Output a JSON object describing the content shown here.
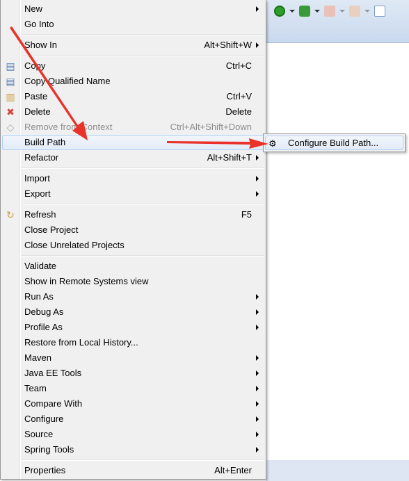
{
  "colors": {
    "arrow": "#e8322a",
    "highlight": "#e2ebf7",
    "menu_bg": "#f0f0f0"
  },
  "menu": {
    "items": [
      {
        "label": "New",
        "shortcut": "",
        "submenu": true
      },
      {
        "label": "Go Into",
        "shortcut": ""
      },
      {
        "separator": true
      },
      {
        "label": "Show In",
        "shortcut": "Alt+Shift+W",
        "submenu": true
      },
      {
        "separator": true
      },
      {
        "label": "Copy",
        "shortcut": "Ctrl+C",
        "icon": "copy-icon"
      },
      {
        "label": "Copy Qualified Name",
        "shortcut": "",
        "icon": "copy-qualified-name-icon"
      },
      {
        "label": "Paste",
        "shortcut": "Ctrl+V",
        "icon": "paste-icon"
      },
      {
        "label": "Delete",
        "shortcut": "Delete",
        "icon": "delete-icon"
      },
      {
        "label": "Remove from Context",
        "shortcut": "Ctrl+Alt+Shift+Down",
        "icon": "remove-context-icon",
        "disabled": true
      },
      {
        "label": "Build Path",
        "shortcut": "",
        "submenu": false,
        "highlighted": true
      },
      {
        "label": "Refactor",
        "shortcut": "Alt+Shift+T",
        "submenu": true
      },
      {
        "separator": true
      },
      {
        "label": "Import",
        "shortcut": "",
        "submenu": true
      },
      {
        "label": "Export",
        "shortcut": "",
        "submenu": true
      },
      {
        "separator": true
      },
      {
        "label": "Refresh",
        "shortcut": "F5",
        "icon": "refresh-icon"
      },
      {
        "label": "Close Project",
        "shortcut": ""
      },
      {
        "label": "Close Unrelated Projects",
        "shortcut": ""
      },
      {
        "separator": true
      },
      {
        "label": "Validate",
        "shortcut": ""
      },
      {
        "label": "Show in Remote Systems view",
        "shortcut": ""
      },
      {
        "label": "Run As",
        "shortcut": "",
        "submenu": true
      },
      {
        "label": "Debug As",
        "shortcut": "",
        "submenu": true
      },
      {
        "label": "Profile As",
        "shortcut": "",
        "submenu": true
      },
      {
        "label": "Restore from Local History...",
        "shortcut": ""
      },
      {
        "label": "Maven",
        "shortcut": "",
        "submenu": true
      },
      {
        "label": "Java EE Tools",
        "shortcut": "",
        "submenu": true
      },
      {
        "label": "Team",
        "shortcut": "",
        "submenu": true
      },
      {
        "label": "Compare With",
        "shortcut": "",
        "submenu": true
      },
      {
        "label": "Configure",
        "shortcut": "",
        "submenu": true
      },
      {
        "label": "Source",
        "shortcut": "",
        "submenu": true
      },
      {
        "label": "Spring Tools",
        "shortcut": "",
        "submenu": true
      },
      {
        "separator": true
      },
      {
        "label": "Properties",
        "shortcut": "Alt+Enter"
      }
    ]
  },
  "submenu": {
    "label": "Configure Build Path...",
    "icon": "configure-build-path-icon"
  }
}
